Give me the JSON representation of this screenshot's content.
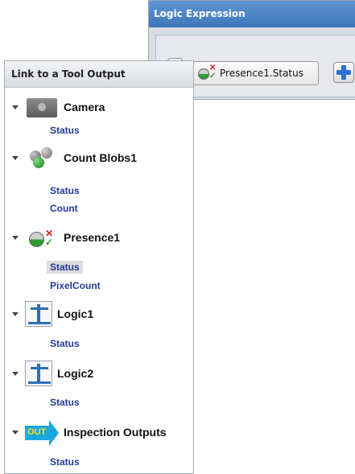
{
  "logic_window": {
    "title": "Logic Expression",
    "token_label": "Presence1.Status"
  },
  "link_panel": {
    "header": "Link to a Tool Output",
    "tools": [
      {
        "name": "Camera",
        "icon": "camera-icon",
        "outputs": [
          "Status"
        ]
      },
      {
        "name": "Count Blobs1",
        "icon": "blobs-icon",
        "outputs": [
          "Status",
          "Count"
        ]
      },
      {
        "name": "Presence1",
        "icon": "presence-icon",
        "outputs": [
          "Status",
          "PixelCount"
        ],
        "selected_output": "Status"
      },
      {
        "name": "Logic1",
        "icon": "logic-icon",
        "outputs": [
          "Status"
        ]
      },
      {
        "name": "Logic2",
        "icon": "logic-icon",
        "outputs": [
          "Status"
        ]
      },
      {
        "name": "Inspection Outputs",
        "icon": "out-icon",
        "outputs": [
          "Status"
        ]
      }
    ],
    "out_icon_text": "OUT"
  }
}
